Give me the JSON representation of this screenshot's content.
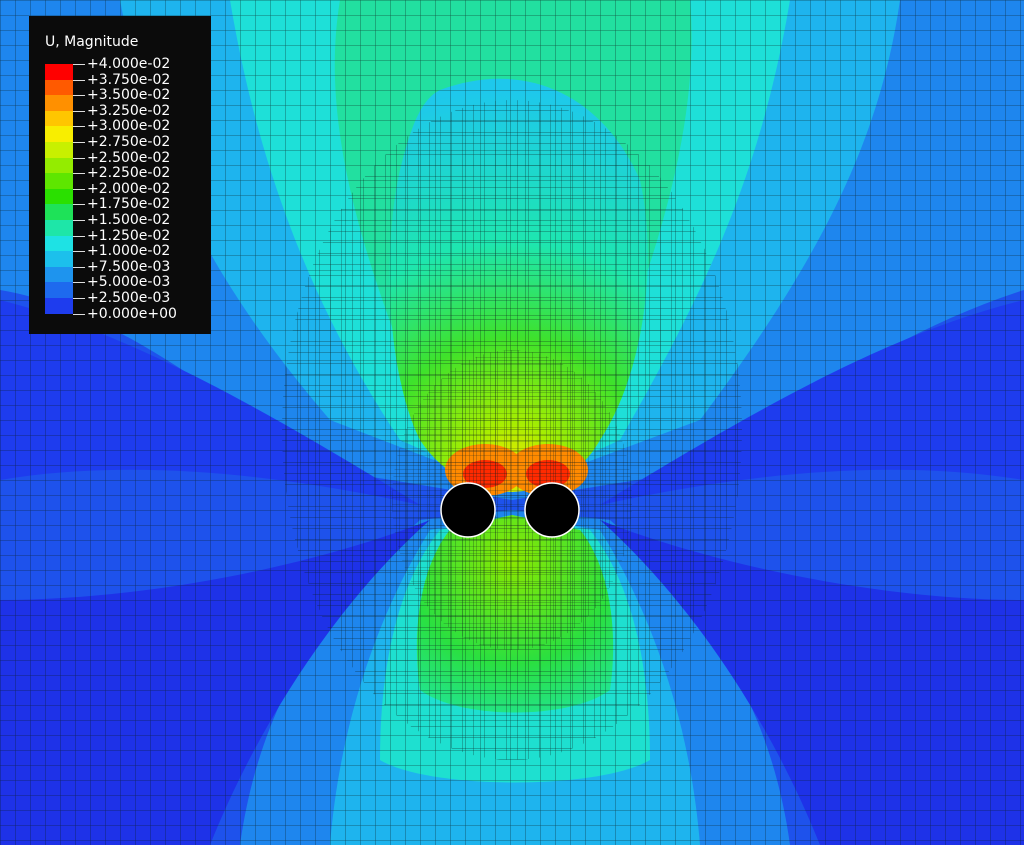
{
  "legend": {
    "title": "U, Magnitude",
    "labels": [
      "+4.000e-02",
      "+3.750e-02",
      "+3.500e-02",
      "+3.250e-02",
      "+3.000e-02",
      "+2.750e-02",
      "+2.500e-02",
      "+2.250e-02",
      "+2.000e-02",
      "+1.750e-02",
      "+1.500e-02",
      "+1.250e-02",
      "+1.000e-02",
      "+7.500e-03",
      "+5.000e-03",
      "+2.500e-03",
      "+0.000e+00"
    ],
    "band_colors": [
      "#ff0000",
      "#ff5a00",
      "#ff9000",
      "#ffc600",
      "#f8ee00",
      "#c8f000",
      "#94ec00",
      "#5ee600",
      "#2ae000",
      "#1ee258",
      "#1ee6a8",
      "#1ee2e4",
      "#1cc0ec",
      "#1e94ee",
      "#1e6aee",
      "#1e3cee"
    ]
  },
  "model": {
    "openings": 2,
    "opening_color": "#000000"
  }
}
